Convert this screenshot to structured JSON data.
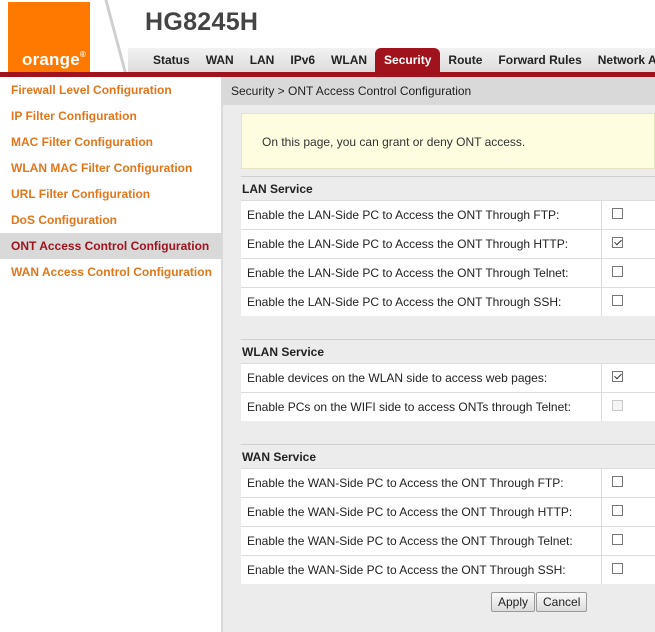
{
  "header": {
    "logo_text": "orange",
    "logo_tm": "®",
    "device_model": "HG8245H",
    "nav_tabs": [
      "Status",
      "WAN",
      "LAN",
      "IPv6",
      "WLAN",
      "Security",
      "Route",
      "Forward Rules",
      "Network A"
    ],
    "active_tab": "Security"
  },
  "colors": {
    "brand_orange": "#ff7900",
    "active_red": "#a0131c",
    "link_orange": "#e2761b",
    "info_bg": "#fffde0"
  },
  "sidebar": {
    "items": [
      "Firewall Level Configuration",
      "IP Filter Configuration",
      "MAC Filter Configuration",
      "WLAN MAC Filter Configuration",
      "URL Filter Configuration",
      "DoS Configuration",
      "ONT Access Control Configuration",
      "WAN Access Control Configuration"
    ],
    "active_item": "ONT Access Control Configuration"
  },
  "main": {
    "breadcrumb": "Security > ONT Access Control Configuration",
    "info_text": "On this page, you can grant or deny ONT access.",
    "lan": {
      "title": "LAN Service",
      "rows": [
        {
          "label": "Enable the LAN-Side PC to Access the ONT Through FTP:",
          "checked": false,
          "disabled": false
        },
        {
          "label": "Enable the LAN-Side PC to Access the ONT Through HTTP:",
          "checked": true,
          "disabled": false
        },
        {
          "label": "Enable the LAN-Side PC to Access the ONT Through Telnet:",
          "checked": false,
          "disabled": false
        },
        {
          "label": "Enable the LAN-Side PC to Access the ONT Through SSH:",
          "checked": false,
          "disabled": false
        }
      ]
    },
    "wlan": {
      "title": "WLAN Service",
      "rows": [
        {
          "label": "Enable devices on the WLAN side to access web pages:",
          "checked": true,
          "disabled": false
        },
        {
          "label": "Enable PCs on the WIFI side to access ONTs through Telnet:",
          "checked": false,
          "disabled": true
        }
      ]
    },
    "wan": {
      "title": "WAN Service",
      "rows": [
        {
          "label": "Enable the WAN-Side PC to Access the ONT Through FTP:",
          "checked": false,
          "disabled": false
        },
        {
          "label": "Enable the WAN-Side PC to Access the ONT Through HTTP:",
          "checked": false,
          "disabled": false
        },
        {
          "label": "Enable the WAN-Side PC to Access the ONT Through Telnet:",
          "checked": false,
          "disabled": false
        },
        {
          "label": "Enable the WAN-Side PC to Access the ONT Through SSH:",
          "checked": false,
          "disabled": false
        }
      ]
    },
    "buttons": {
      "apply": "Apply",
      "cancel": "Cancel"
    }
  }
}
